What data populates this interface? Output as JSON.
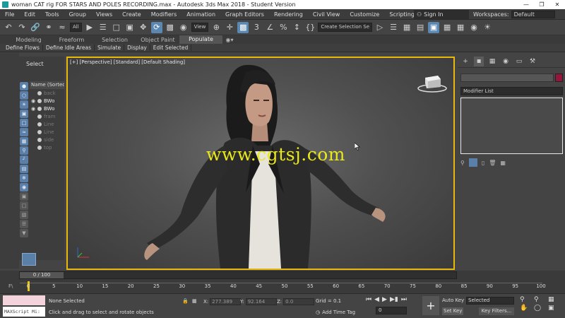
{
  "window": {
    "title": "woman CAT rig FOR STARS AND POLES RECORDING.max - Autodesk 3ds Max 2018 - Student Version",
    "controls": [
      "—",
      "❐",
      "✕"
    ]
  },
  "menu": {
    "items": [
      "File",
      "Edit",
      "Tools",
      "Group",
      "Views",
      "Create",
      "Modifiers",
      "Animation",
      "Graph Editors",
      "Rendering",
      "Civil View",
      "Customize",
      "Scripting"
    ],
    "sign_in": "Sign In",
    "workspaces_label": "Workspaces:",
    "workspaces_value": "Default"
  },
  "toolbar": {
    "filter_value": "All",
    "view_value": "View",
    "selection_set_value": "Create Selection Se",
    "snap_value": "3"
  },
  "ribbon": {
    "tabs": [
      "Modeling",
      "Freeform",
      "Selection",
      "Object Paint",
      "Populate"
    ],
    "active_tab": "Populate",
    "sub_items": [
      "Define Flows",
      "Define Idle Areas",
      "Simulate",
      "Display",
      "Edit Selected"
    ]
  },
  "scene_explorer": {
    "title": "Select",
    "column_header": "Name (Sorted A",
    "rows": [
      {
        "label": "back",
        "visible": false,
        "bright": false
      },
      {
        "label": "BWo",
        "visible": true,
        "bright": true
      },
      {
        "label": "BWo",
        "visible": true,
        "bright": true
      },
      {
        "label": "fram",
        "visible": false,
        "bright": false
      },
      {
        "label": "Line",
        "visible": false,
        "bright": false
      },
      {
        "label": "Line",
        "visible": false,
        "bright": false
      },
      {
        "label": "side",
        "visible": false,
        "bright": false
      },
      {
        "label": "top",
        "visible": false,
        "bright": false
      }
    ]
  },
  "viewport": {
    "label": "[+] [Perspective] [Standard] [Default Shading]",
    "watermark": "www.cgtsj.com"
  },
  "command_panel": {
    "modifier_list": "Modifier List",
    "object_color": "#96163b"
  },
  "timeline": {
    "slider_label": "0 / 100",
    "ticks": [
      0,
      5,
      10,
      15,
      20,
      25,
      30,
      35,
      40,
      45,
      50,
      55,
      60,
      65,
      70,
      75,
      80,
      85,
      90,
      95,
      100
    ],
    "track_start_label": "F\\"
  },
  "status": {
    "maxscript": "MAXScript Mi:",
    "selection": "None Selected",
    "prompt": "Click and drag to select and rotate objects",
    "x_label": "X:",
    "x_value": "277.389",
    "y_label": "Y:",
    "y_value": "92.164",
    "z_label": "Z:",
    "z_value": "0.0",
    "grid": "Grid = 0.1",
    "add_time_tag": "Add Time Tag",
    "frame_value": "0",
    "auto_key": "Auto Key",
    "set_key": "Set Key",
    "key_mode": "Selected",
    "key_filters": "Key Filters..."
  },
  "colors": {
    "viewport_border": "#e8b80c",
    "watermark": "#e8e81a",
    "active_button": "#5b87b3",
    "time_key": "#e9c613"
  }
}
